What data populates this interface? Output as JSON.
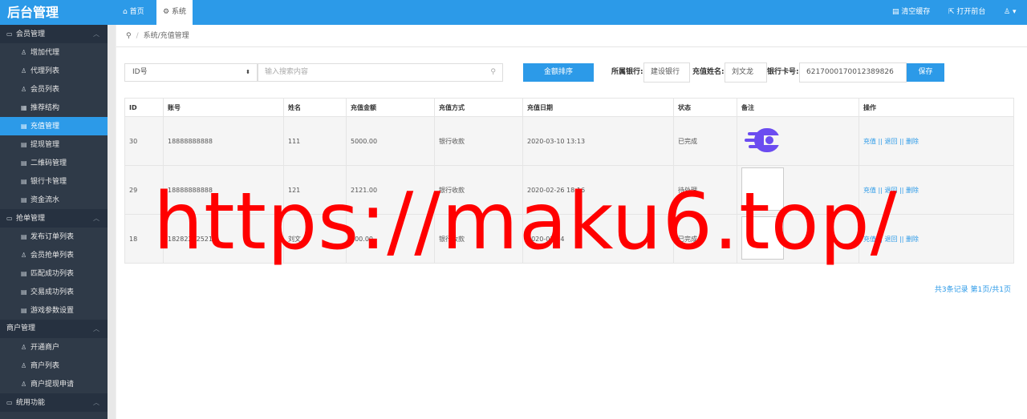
{
  "app": {
    "brand": "后台管理"
  },
  "top_tabs": [
    {
      "label": "首页",
      "icon": "home-icon"
    },
    {
      "label": "系统",
      "icon": "gear-icon"
    }
  ],
  "top_right": {
    "clear_cache": "清空缓存",
    "open_front": "打开前台"
  },
  "sidebar": {
    "groups": [
      {
        "label": "会员管理",
        "items": [
          "增加代理",
          "代理列表",
          "会员列表",
          "推荐结构",
          "充值管理",
          "提现管理",
          "二维码管理",
          "银行卡管理",
          "资金流水"
        ]
      },
      {
        "label": "抢单管理",
        "items": [
          "发布订单列表",
          "会员抢单列表",
          "匹配成功列表",
          "交易成功列表",
          "游戏参数设置"
        ]
      },
      {
        "label": "商户管理",
        "items": [
          "开通商户",
          "商户列表",
          "商户提现申请"
        ]
      },
      {
        "label": "统用功能",
        "items": []
      }
    ],
    "active_item": "充值管理"
  },
  "breadcrumb": {
    "path": "系统/充值管理"
  },
  "filter": {
    "select_value": "ID号",
    "search_placeholder": "输入搜索内容",
    "sort_button": "金额排序",
    "bank_label": "所属银行:",
    "bank_value": "建设银行",
    "name_label": "充值姓名:",
    "name_value": "刘文龙",
    "card_label": "银行卡号:",
    "card_value": "6217000170012389826",
    "save_button": "保存"
  },
  "table": {
    "headers": [
      "ID",
      "账号",
      "姓名",
      "充值金额",
      "充值方式",
      "充值日期",
      "状态",
      "备注",
      "操作"
    ],
    "rows": [
      {
        "id": "30",
        "account": "18888888888",
        "name": "111",
        "amount": "5000.00",
        "method": "银行收款",
        "date": "2020-03-10 13:13",
        "status": "已完成",
        "note": "logo",
        "ops": "充值 || 退回 || 删除"
      },
      {
        "id": "29",
        "account": "18888888888",
        "name": "121",
        "amount": "2121.00",
        "method": "银行收款",
        "date": "2020-02-26 18:16",
        "status": "待处理",
        "note": "broken",
        "ops": "充值 || 退回 || 删除"
      },
      {
        "id": "18",
        "account": "18282202521",
        "name": "刘文",
        "amount": "100.00",
        "method": "银行收款",
        "date": "2020-02-24",
        "status": "已完成",
        "note": "broken",
        "ops": "充值 || 退回 || 删除"
      }
    ]
  },
  "pager": {
    "text": "共3条记录 第1页/共1页"
  },
  "watermark": "https://maku6.top/"
}
